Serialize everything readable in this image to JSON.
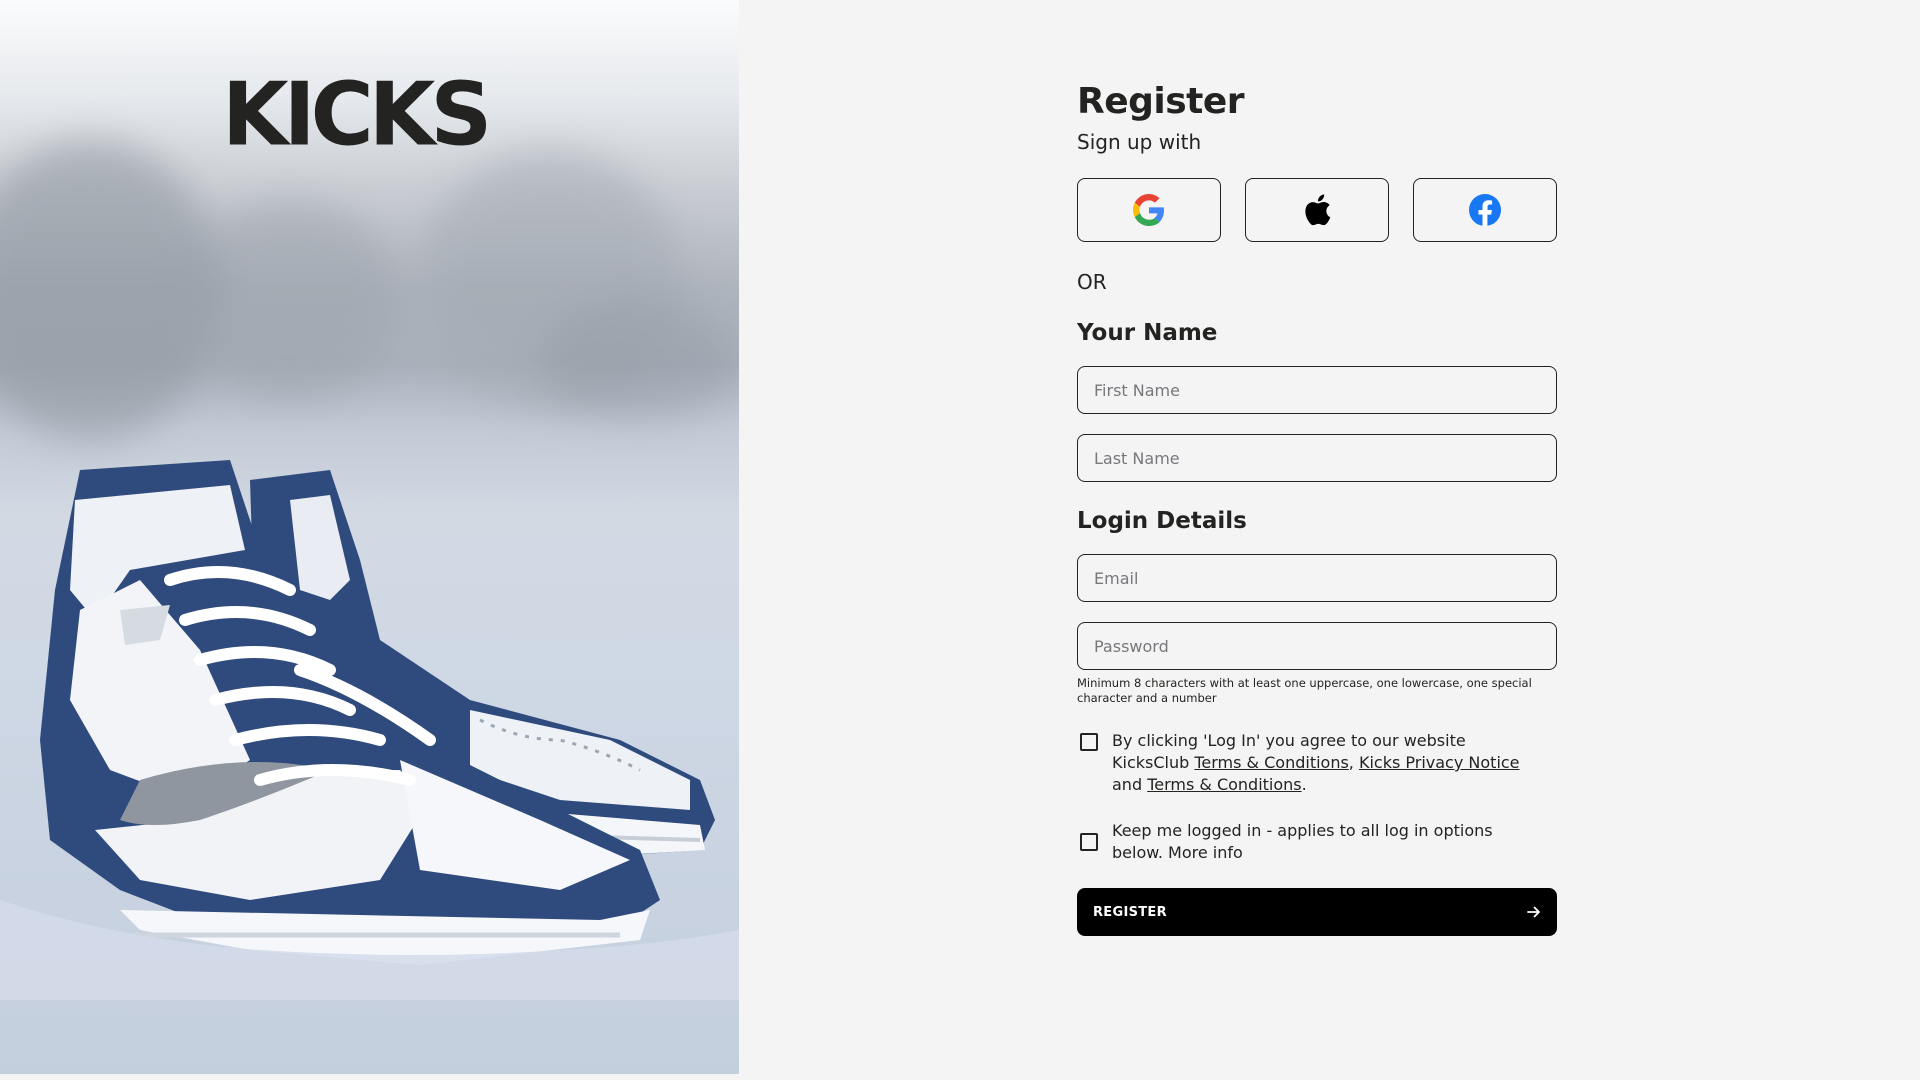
{
  "brand": {
    "logo_text": "KICKS"
  },
  "hero": {
    "image": "high-top-sneakers-in-snow"
  },
  "form": {
    "title": "Register",
    "subtitle": "Sign up with",
    "social": [
      {
        "name": "google",
        "icon": "google-icon"
      },
      {
        "name": "apple",
        "icon": "apple-icon"
      },
      {
        "name": "facebook",
        "icon": "facebook-icon"
      }
    ],
    "or_text": "OR",
    "name_section": {
      "title": "Your Name",
      "first_name_placeholder": "First Name",
      "last_name_placeholder": "Last Name"
    },
    "login_section": {
      "title": "Login Details",
      "email_placeholder": "Email",
      "password_placeholder": "Password",
      "password_hint": "Minimum 8 characters with at least one uppercase, one lowercase, one special character and a number"
    },
    "terms": {
      "prefix": "By clicking 'Log In' you agree to our website KicksClub ",
      "link1": "Terms & Conditions",
      "sep1": ", ",
      "link2": "Kicks Privacy Notice",
      "sep2": " and ",
      "link3": "Terms & Conditions",
      "suffix": "."
    },
    "keep_logged_in": "Keep me logged in - applies to all log in options below. More info",
    "register_label": "REGISTER",
    "register_icon": "arrow-right-icon"
  },
  "colors": {
    "text": "#232321",
    "background": "#f4f4f4",
    "button": "#000000",
    "sneaker_blue": "#2f4a7c"
  }
}
